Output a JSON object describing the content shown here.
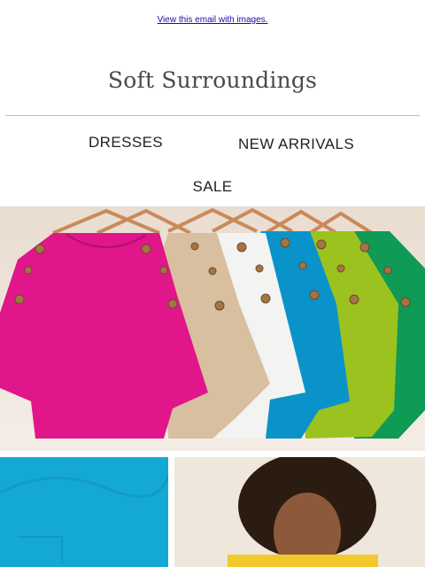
{
  "header": {
    "view_link": "View this email with images.",
    "brand": "Soft Surroundings"
  },
  "nav": {
    "dresses": "DRESSES",
    "new_arrivals": "NEW ARRIVALS",
    "sale": "SALE"
  },
  "colors": {
    "magenta": "#e0168a",
    "tan": "#d8bfa0",
    "white": "#f3f3f1",
    "blue": "#0a93c8",
    "lime": "#9cc21f",
    "green": "#0f9a55",
    "turquoise": "#14a9d4"
  }
}
